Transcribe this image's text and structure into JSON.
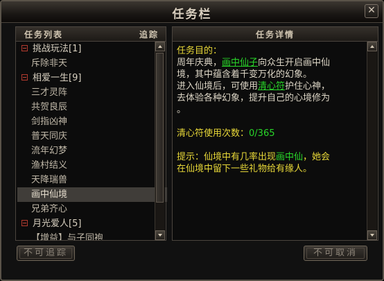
{
  "window": {
    "title": "任务栏",
    "close_label": "✕"
  },
  "list_panel": {
    "title": "任务列表",
    "track_label": "追踪",
    "items": [
      {
        "type": "category",
        "label": "挑战玩法[1]"
      },
      {
        "type": "task",
        "label": "斥除非天"
      },
      {
        "type": "category",
        "label": "相爱一生[9]"
      },
      {
        "type": "task",
        "label": "三才灵阵"
      },
      {
        "type": "task",
        "label": "共贺良辰"
      },
      {
        "type": "task",
        "label": "剑指凶神"
      },
      {
        "type": "task",
        "label": "普天同庆"
      },
      {
        "type": "task",
        "label": "流年幻梦"
      },
      {
        "type": "task",
        "label": "渔村结义"
      },
      {
        "type": "task",
        "label": "天降瑞兽"
      },
      {
        "type": "task",
        "label": "画中仙境",
        "selected": true
      },
      {
        "type": "task",
        "label": "兄弟齐心"
      },
      {
        "type": "category",
        "label": "月光爱人[5]"
      },
      {
        "type": "task",
        "label": "【增益】与子同袍"
      }
    ]
  },
  "detail_panel": {
    "title": "任务详情",
    "goal_label": "任务目的：",
    "goal_l1_a": "周年庆典，",
    "goal_l1_link": "画中仙子",
    "goal_l1_b": "向众生开启画中仙",
    "goal_l2": "境，其中蕴含着千变万化的幻象。",
    "goal_l3_a": "进入仙境后，可使用",
    "goal_l3_link": "清心符",
    "goal_l3_b": "护住心神，",
    "goal_l4": "去体验各种幻象，提升自己的心境修为",
    "goal_l5": "。",
    "count_label": "清心符使用次数：",
    "count_value": "0/365",
    "tip_label": "提示：",
    "tip_l1_a": "仙境中有几率出现",
    "tip_l1_link": "画中仙",
    "tip_l1_b": "，她会",
    "tip_l2": "在仙境中留下一些礼物给有缘人。"
  },
  "buttons": {
    "untrack": "不可追踪",
    "cancel": "不可取消"
  }
}
